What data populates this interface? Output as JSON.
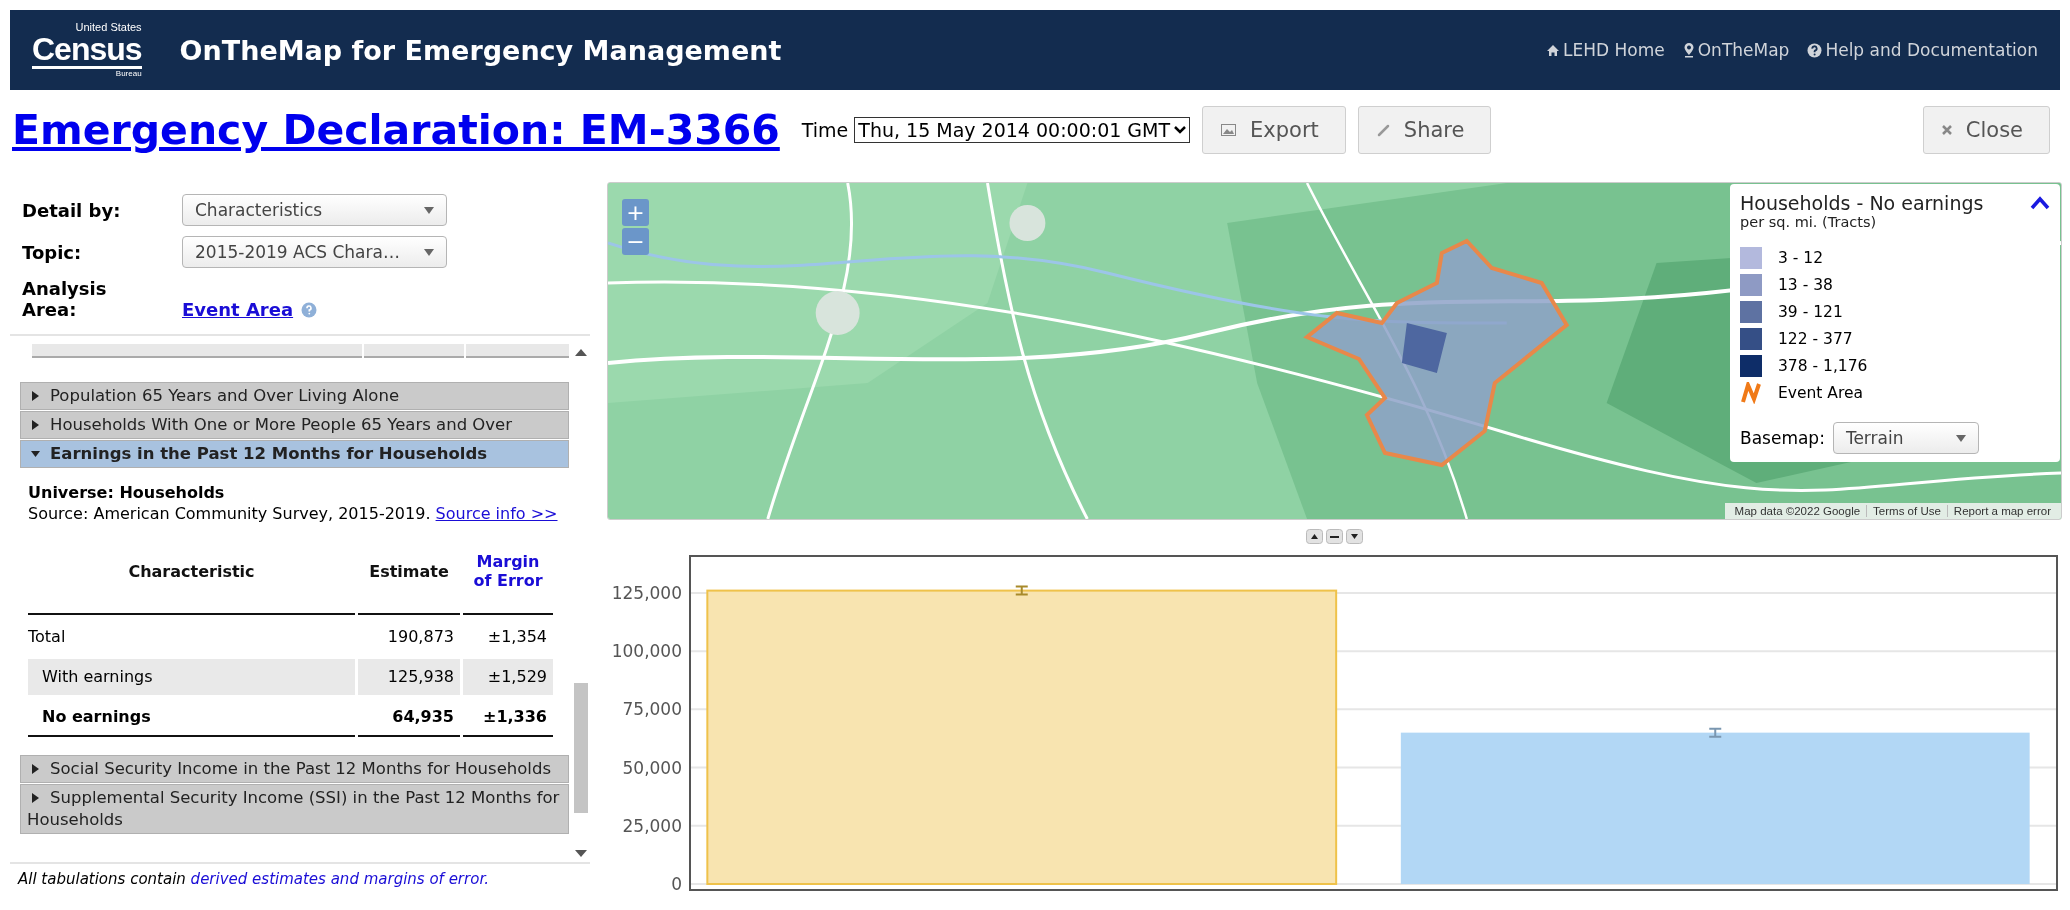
{
  "header": {
    "logo": {
      "top": "United States",
      "main": "Census",
      "bottom": "Bureau"
    },
    "app_title": "OnTheMap for Emergency Management",
    "links": [
      {
        "label": "LEHD Home"
      },
      {
        "label": "OnTheMap"
      },
      {
        "label": "Help and Documentation"
      }
    ]
  },
  "title": "Emergency Declaration: EM-3366",
  "time": {
    "label": "Time",
    "value": "Thu, 15 May 2014 00:00:01 GMT"
  },
  "buttons": [
    {
      "label": "Export"
    },
    {
      "label": "Share"
    }
  ],
  "close_button": "Close",
  "filters": [
    {
      "label": "Detail by:",
      "value": "Characteristics"
    },
    {
      "label": "Topic:",
      "value": "2015-2019 ACS Chara…"
    }
  ],
  "analysis_area": {
    "label": "Analysis Area:",
    "value": "Event Area"
  },
  "sections": [
    {
      "title": "Population 65 Years and Over Living Alone",
      "expanded": false
    },
    {
      "title": "Households With One or More People 65 Years and Over",
      "expanded": false
    },
    {
      "title": "Earnings in the Past 12 Months for Households",
      "expanded": true,
      "universe": "Universe: Households",
      "source": "Source: American Community Survey, 2015-2019.",
      "source_link": "Source info >>",
      "table": {
        "columns": [
          "Characteristic",
          "Estimate",
          "Margin of Error"
        ],
        "rows": [
          {
            "label": "Total",
            "estimate": "190,873",
            "moe": "±1,354",
            "selected": false,
            "children": [
              {
                "label": "With earnings",
                "estimate": "125,938",
                "moe": "±1,529",
                "selected": false
              },
              {
                "label": "No earnings",
                "estimate": "64,935",
                "moe": "±1,336",
                "selected": true
              }
            ]
          }
        ]
      }
    },
    {
      "title": "Social Security Income in the Past 12 Months for Households",
      "expanded": false
    },
    {
      "title": "Supplemental Security Income (SSI) in the Past 12 Months for Households",
      "expanded": false
    }
  ],
  "footnote": {
    "text": "All tabulations contain",
    "link": "derived estimates and margins of error."
  },
  "map": {
    "zoom_in": "+",
    "zoom_out": "−",
    "legend": {
      "title": "Households - No earnings",
      "subtitle": "per sq. mi. (Tracts)",
      "items": [
        {
          "kind": "swatch",
          "label": "3 - 12",
          "color": "#b3b9dd"
        },
        {
          "kind": "swatch",
          "label": "13 - 38",
          "color": "#8e9ac4"
        },
        {
          "kind": "swatch",
          "label": "39 - 121",
          "color": "#5e72a2"
        },
        {
          "kind": "swatch",
          "label": "122 - 377",
          "color": "#354f86"
        },
        {
          "kind": "swatch",
          "label": "378 - 1,176",
          "color": "#0e2d68"
        },
        {
          "kind": "outline",
          "label": "Event Area"
        }
      ],
      "basemap_label": "Basemap:",
      "basemap_value": "Terrain"
    },
    "attribution": [
      "Map data ©2022 Google",
      "Terms of Use",
      "Report a map error"
    ]
  },
  "chart": {
    "chart_data": {
      "type": "bar",
      "ylim": [
        0,
        140000
      ],
      "yticks": [
        {
          "value": 0,
          "label": "0"
        },
        {
          "value": 25000,
          "label": "25,000"
        },
        {
          "value": 50000,
          "label": "50,000"
        },
        {
          "value": 75000,
          "label": "75,000"
        },
        {
          "value": 100000,
          "label": "100,000"
        },
        {
          "value": 125000,
          "label": "125,000"
        }
      ],
      "series": [
        {
          "color": "#f8e4b0",
          "values": [
            126000,
            null
          ]
        },
        {
          "color": "#b2d7f5",
          "values": [
            null,
            65000
          ]
        }
      ],
      "grid": true
    }
  }
}
